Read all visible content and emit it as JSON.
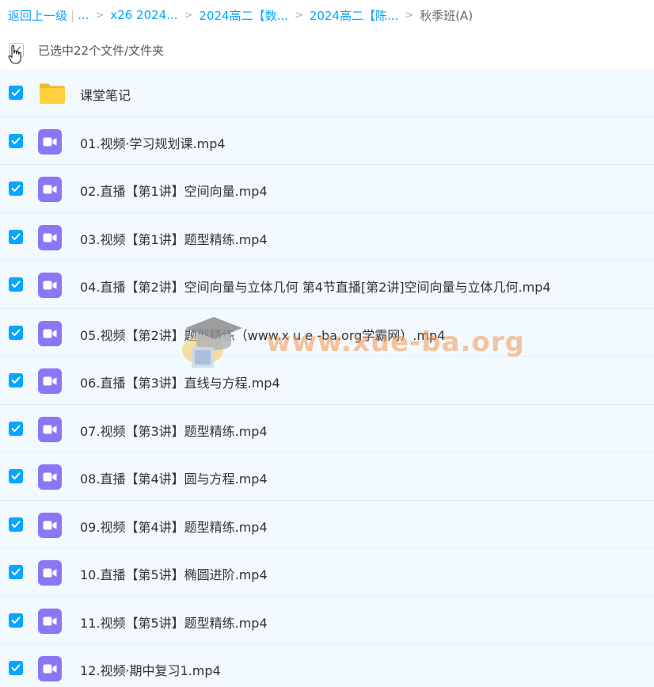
{
  "breadcrumb": {
    "back": "返回上一级",
    "ellipsis": "...",
    "items": [
      "x26 2024...",
      "2024高二【数...",
      "2024高二【陈..."
    ],
    "current": "秋季班(A)"
  },
  "selection": {
    "text": "已选中22个文件/文件夹"
  },
  "files": [
    {
      "name": "课堂笔记",
      "icon": "folder-icon",
      "checked": true
    },
    {
      "name": "01.视频·学习规划课.mp4",
      "icon": "video-icon",
      "checked": true
    },
    {
      "name": "02.直播【第1讲】空间向量.mp4",
      "icon": "video-icon",
      "checked": true
    },
    {
      "name": "03.视频【第1讲】题型精练.mp4",
      "icon": "video-icon",
      "checked": true
    },
    {
      "name": "04.直播【第2讲】空间向量与立体几何 第4节直播[第2讲]空间向量与立体几何.mp4",
      "icon": "video-icon",
      "checked": true
    },
    {
      "name": "05.视频【第2讲】题型精练（www.x u e -ba.org学霸网）.mp4",
      "icon": "video-icon",
      "checked": true
    },
    {
      "name": "06.直播【第3讲】直线与方程.mp4",
      "icon": "video-icon",
      "checked": true
    },
    {
      "name": "07.视频【第3讲】题型精练.mp4",
      "icon": "video-icon",
      "checked": true
    },
    {
      "name": "08.直播【第4讲】圆与方程.mp4",
      "icon": "video-icon",
      "checked": true
    },
    {
      "name": "09.视频【第4讲】题型精练.mp4",
      "icon": "video-icon",
      "checked": true
    },
    {
      "name": "10.直播【第5讲】椭圆进阶.mp4",
      "icon": "video-icon",
      "checked": true
    },
    {
      "name": "11.视频【第5讲】题型精练.mp4",
      "icon": "video-icon",
      "checked": true
    },
    {
      "name": "12.视频·期中复习1.mp4",
      "icon": "video-icon",
      "checked": true
    }
  ],
  "watermark": {
    "text": "www.xue-ba.org"
  },
  "colors": {
    "accent": "#06a7ff",
    "video_icon": "#8b77f5",
    "folder_icon": "#ffcf3e",
    "row_bg": "#f2f9ff"
  }
}
